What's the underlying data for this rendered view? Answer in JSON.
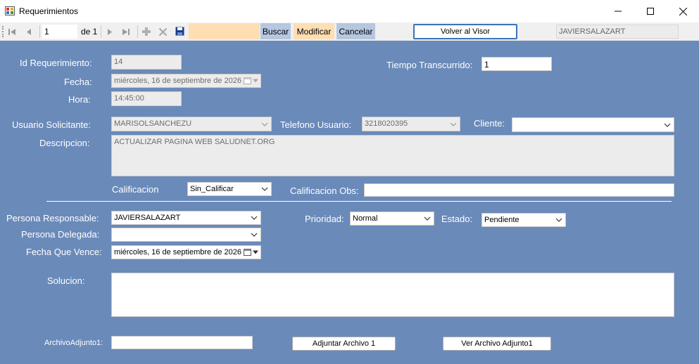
{
  "window": {
    "title": "Requerimientos",
    "minimize_icon": "minimize-icon",
    "maximize_icon": "maximize-icon",
    "close_icon": "close-icon"
  },
  "toolbar": {
    "position_value": "1",
    "count_label": "de 1",
    "buscar_label": "Buscar",
    "modificar_label": "Modificar",
    "cancelar_label": "Cancelar",
    "visor_label": "Volver al Visor",
    "current_user": "JAVIERSALAZART",
    "icons": [
      "move-first-icon",
      "move-previous-icon",
      "move-next-icon",
      "move-last-icon",
      "add-new-icon",
      "delete-icon",
      "save-icon"
    ]
  },
  "form": {
    "id_label": "Id Requerimiento:",
    "id_value": "14",
    "fecha_label": "Fecha:",
    "fecha_value": "miércoles, 16 de septiembre de 2026",
    "hora_label": "Hora:",
    "hora_value": "14:45:00",
    "tiempo_label": "Tiempo Transcurrido:",
    "tiempo_value": "1",
    "usuario_label": "Usuario Solicitante:",
    "usuario_value": "MARISOLSANCHEZU",
    "telefono_label": "Telefono Usuario:",
    "telefono_value": "3218020395",
    "cliente_label": "Cliente:",
    "cliente_value": "",
    "descripcion_label": "Descripcion:",
    "descripcion_value": "ACTUALIZAR PAGINA WEB SALUDNET.ORG",
    "calificacion_label": "Calificacion",
    "calificacion_value": "Sin_Calificar",
    "calificacion_obs_label": "Calificacion Obs:",
    "calificacion_obs_value": "",
    "responsable_label": "Persona Responsable:",
    "responsable_value": "JAVIERSALAZART",
    "delegada_label": "Persona Delegada:",
    "delegada_value": "",
    "vence_label": "Fecha Que Vence:",
    "vence_value": "miércoles, 16 de septiembre de 2026",
    "prioridad_label": "Prioridad:",
    "prioridad_value": "Normal",
    "estado_label": "Estado:",
    "estado_value": "Pendiente",
    "solucion_label": "Solucion:",
    "solucion_value": "",
    "archivo_label": "ArchivoAdjunto1:",
    "archivo_value": "",
    "adjuntar_label": "Adjuntar Archivo 1",
    "ver_label": "Ver Archivo Adjunto1"
  }
}
